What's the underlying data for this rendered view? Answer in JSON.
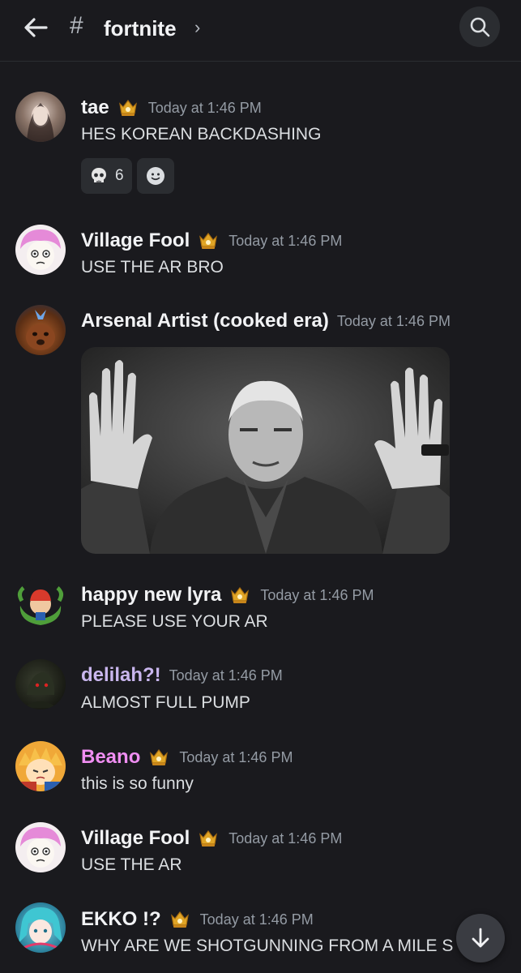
{
  "header": {
    "channel_name": "fortnite",
    "hash": "#",
    "chevron": "›",
    "back_icon": "arrow-left-icon",
    "search_icon": "search-icon"
  },
  "messages": [
    {
      "author": "tae",
      "time": "Today at 1:46 PM",
      "text": "HES KOREAN BACKDASHING",
      "author_color": "#f2f3f5",
      "has_badge": true
    },
    {
      "author": "Village Fool",
      "time": "Today at 1:46 PM",
      "text": "USE THE AR BRO",
      "author_color": "#f2f3f5",
      "has_badge": true
    },
    {
      "author": "Arsenal Artist (cooked era)",
      "time": "Today at 1:46 PM",
      "text": "",
      "author_color": "#f2f3f5",
      "has_badge": false
    },
    {
      "author": "happy new lyra",
      "time": "Today at 1:46 PM",
      "text": "PLEASE USE YOUR AR",
      "author_color": "#f2f3f5",
      "has_badge": true
    },
    {
      "author": "delilah?!",
      "time": "Today at 1:46 PM",
      "text": "ALMOST FULL PUMP",
      "author_color": "#c9b6ee",
      "has_badge": false
    },
    {
      "author": "Beano",
      "time": "Today at 1:46 PM",
      "text": "this is so funny",
      "author_color": "#f08ef2",
      "has_badge": true
    },
    {
      "author": "Village Fool",
      "time": "Today at 1:46 PM",
      "text": "USE THE AR",
      "author_color": "#f2f3f5",
      "has_badge": true
    },
    {
      "author": "EKKO !?",
      "time": "Today at 1:46 PM",
      "text": "WHY ARE WE SHOTGUNNING FROM A MILE S",
      "author_color": "#f2f3f5",
      "has_badge": true
    }
  ],
  "reactions": [
    {
      "icon": "skull-icon",
      "count": "6"
    },
    {
      "icon": "add-reaction-icon",
      "count": ""
    }
  ],
  "colors": {
    "background": "#1a1a1e",
    "muted": "#949ba4",
    "badge_gold": "#e0a526"
  }
}
